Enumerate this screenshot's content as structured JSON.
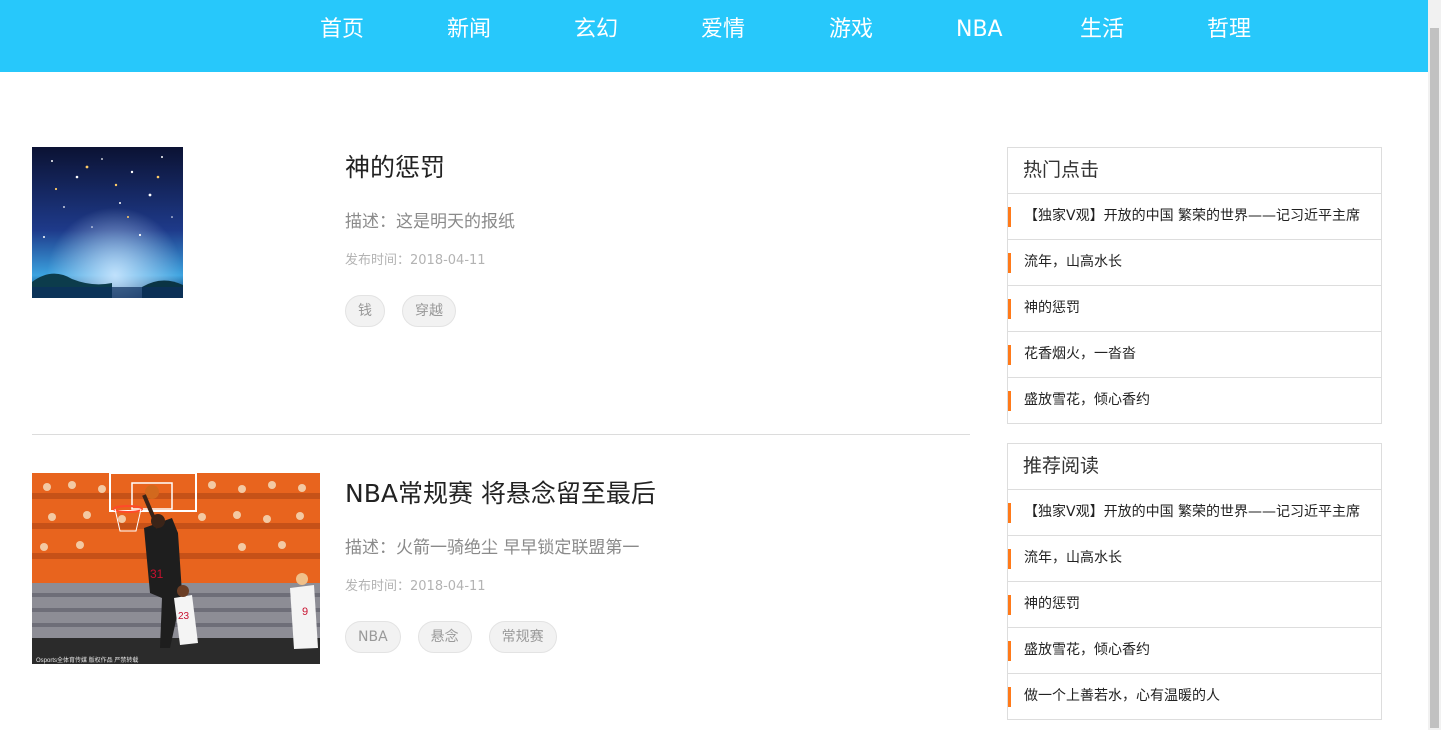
{
  "nav": {
    "items": [
      {
        "label": "首页"
      },
      {
        "label": "新闻"
      },
      {
        "label": "玄幻"
      },
      {
        "label": "爱情"
      },
      {
        "label": "游戏"
      },
      {
        "label": "NBA"
      },
      {
        "label": "生活"
      },
      {
        "label": "哲理"
      }
    ],
    "bg_color": "#27c8fb"
  },
  "articles": [
    {
      "title": "神的惩罚",
      "desc": "描述：这是明天的报纸",
      "date": "发布时间：2018-04-11",
      "tags": [
        "钱",
        "穿越"
      ],
      "image": "starry-night-image"
    },
    {
      "title": "NBA常规赛 将悬念留至最后",
      "desc": "描述：火箭一骑绝尘 早早锁定联盟第一",
      "date": "发布时间：2018-04-11",
      "tags": [
        "NBA",
        "悬念",
        "常规赛"
      ],
      "image": "basketball-dunk-image",
      "image_caption": "Osports全体育传媒 版权作品 严禁转载"
    }
  ],
  "sidebar": {
    "hot": {
      "title": "热门点击",
      "items": [
        "【独家V观】开放的中国 繁荣的世界——记习近平主席",
        "流年，山高水长",
        "神的惩罚",
        "花香烟火，一沓沓",
        "盛放雪花，倾心香约"
      ]
    },
    "recommend": {
      "title": "推荐阅读",
      "items": [
        "【独家V观】开放的中国 繁荣的世界——记习近平主席",
        "流年，山高水长",
        "神的惩罚",
        "盛放雪花，倾心香约",
        "做一个上善若水，心有温暖的人"
      ]
    },
    "accent_color": "#ff7a1a"
  }
}
